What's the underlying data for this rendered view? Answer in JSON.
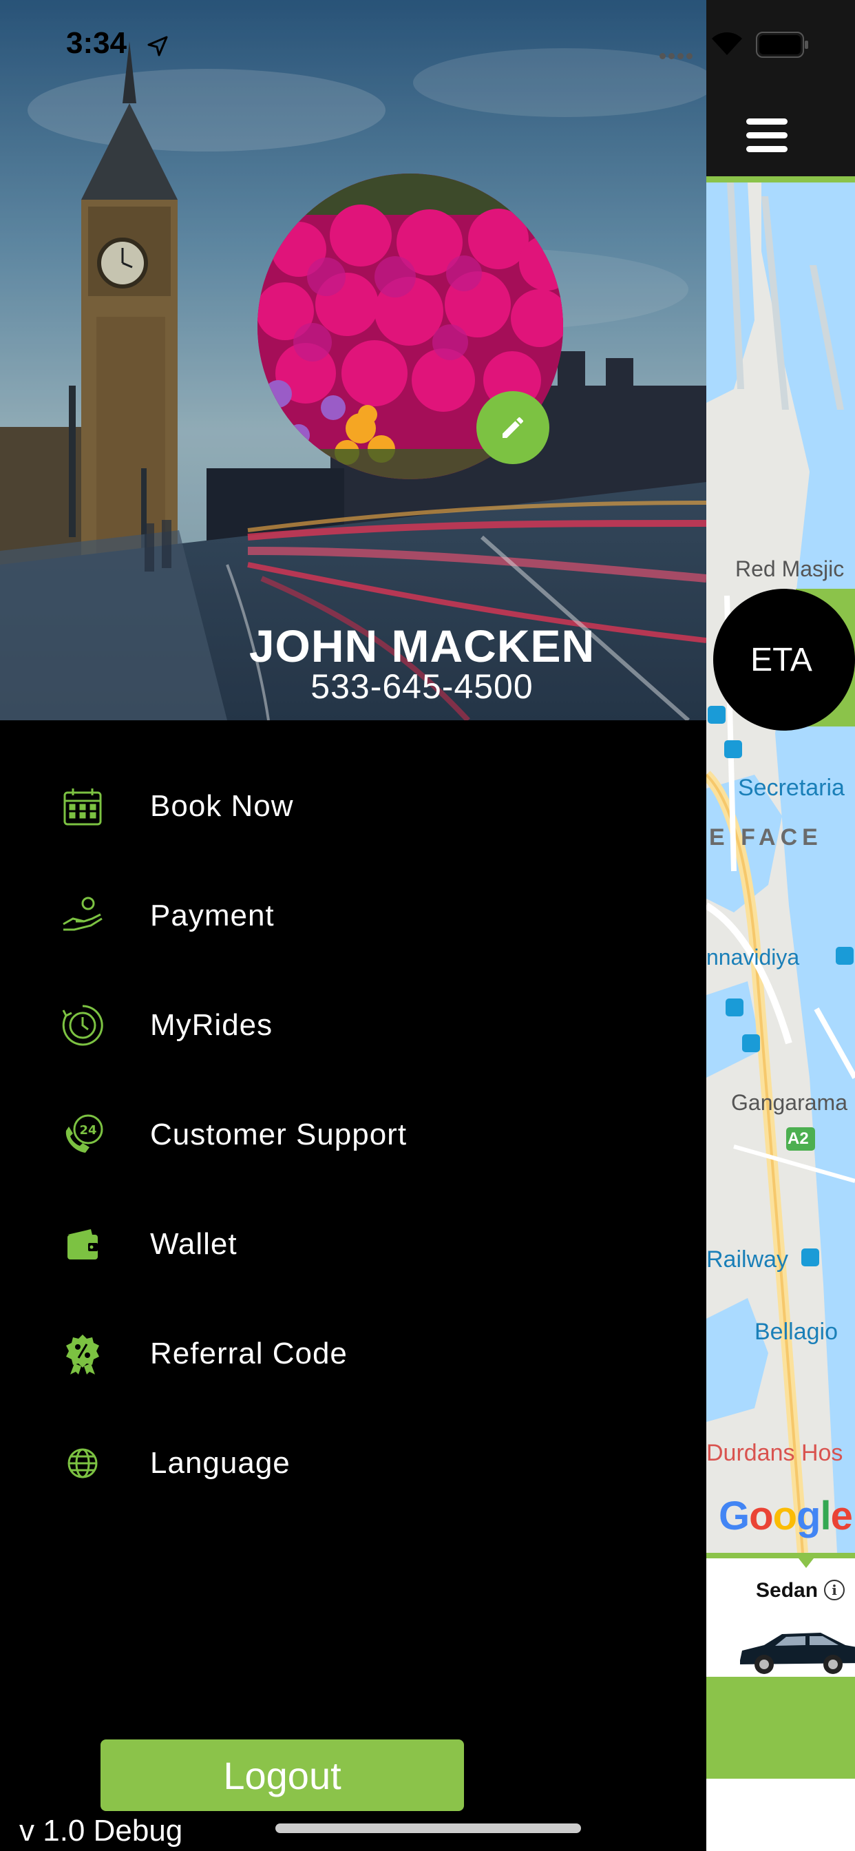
{
  "status_bar": {
    "time": "3:34"
  },
  "profile": {
    "name": "JOHN MACKEN",
    "phone": "533-645-4500"
  },
  "menu": {
    "items": [
      {
        "label": "Book Now",
        "icon": "calendar-icon"
      },
      {
        "label": "Payment",
        "icon": "payment-hand-icon"
      },
      {
        "label": "MyRides",
        "icon": "ride-history-icon"
      },
      {
        "label": "Customer Support",
        "icon": "support-24-icon"
      },
      {
        "label": "Wallet",
        "icon": "wallet-icon"
      },
      {
        "label": "Referral Code",
        "icon": "referral-badge-icon"
      },
      {
        "label": "Language",
        "icon": "globe-icon"
      }
    ]
  },
  "logout_label": "Logout",
  "version": "v 1.0 Debug",
  "map": {
    "eta_label": "ETA",
    "labels": [
      "Red Masjic",
      "Secretaria",
      "E FACE",
      "nnavidiya",
      "Gangarama",
      "A2",
      "Railway",
      "Bellagio",
      "Durdans Hos"
    ],
    "google_logo": "Google",
    "vehicle": {
      "name": "Sedan",
      "info_icon": "info-icon"
    }
  },
  "colors": {
    "accent": "#8bc34a",
    "drawer_bg": "#000000",
    "eta_bg": "#000000",
    "water": "#aadaff"
  }
}
